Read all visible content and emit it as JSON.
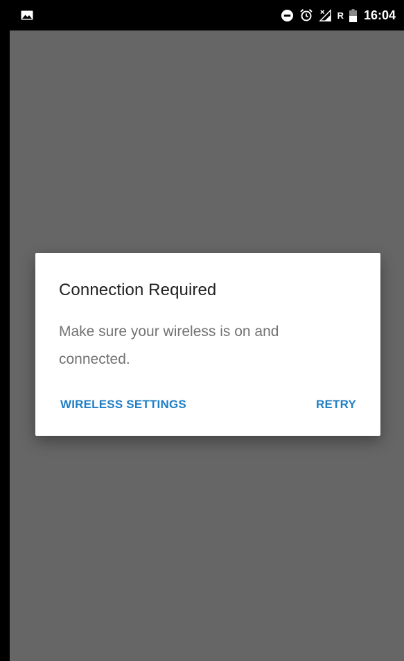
{
  "status_bar": {
    "time": "16:04",
    "roaming_indicator": "R",
    "icons": [
      "image-notification-icon",
      "do-not-disturb-icon",
      "alarm-icon",
      "no-signal-icon",
      "battery-icon"
    ]
  },
  "dialog": {
    "title": "Connection Required",
    "message": "Make sure your wireless is on and connected.",
    "buttons": {
      "wireless_settings": "WIRELESS SETTINGS",
      "retry": "RETRY"
    }
  },
  "colors": {
    "scrim": "#666666",
    "accent": "#1f7fc6",
    "title": "#212121",
    "message": "#737373"
  }
}
